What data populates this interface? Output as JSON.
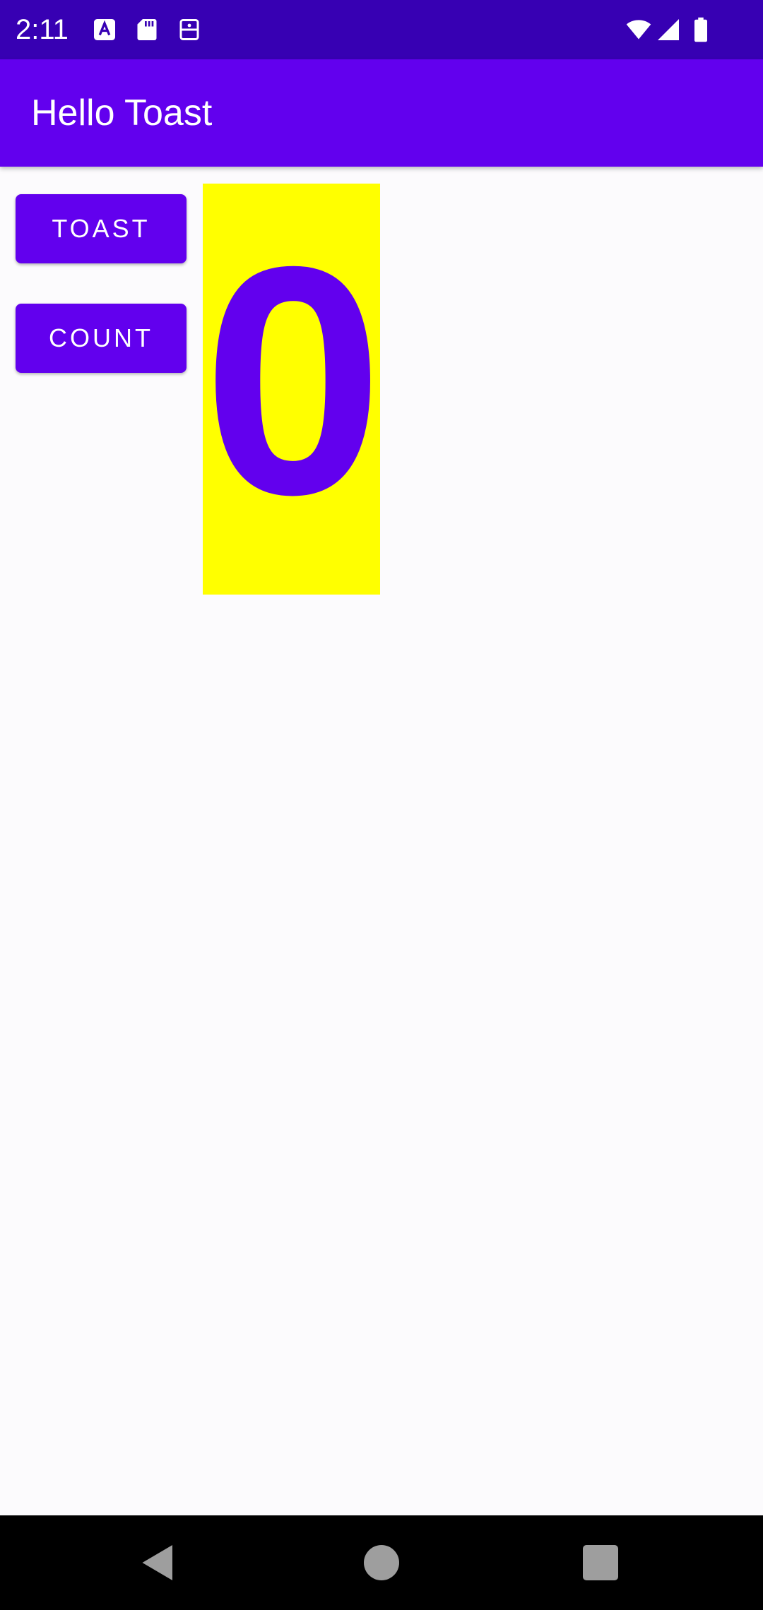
{
  "status_bar": {
    "time": "2:11",
    "icons": [
      "font-a-icon",
      "sd-card-icon",
      "cast-icon",
      "wifi-icon",
      "cellular-signal-icon",
      "battery-icon"
    ]
  },
  "app_bar": {
    "title": "Hello Toast"
  },
  "buttons": {
    "toast_label": "TOAST",
    "count_label": "COUNT"
  },
  "counter": {
    "value": "0"
  },
  "nav_bar": {
    "items": [
      "back-icon",
      "home-icon",
      "recents-icon"
    ]
  },
  "colors": {
    "status_bar": "#3700b3",
    "primary": "#6200ee",
    "count_background": "#ffff00",
    "background": "#fcfbfd"
  }
}
